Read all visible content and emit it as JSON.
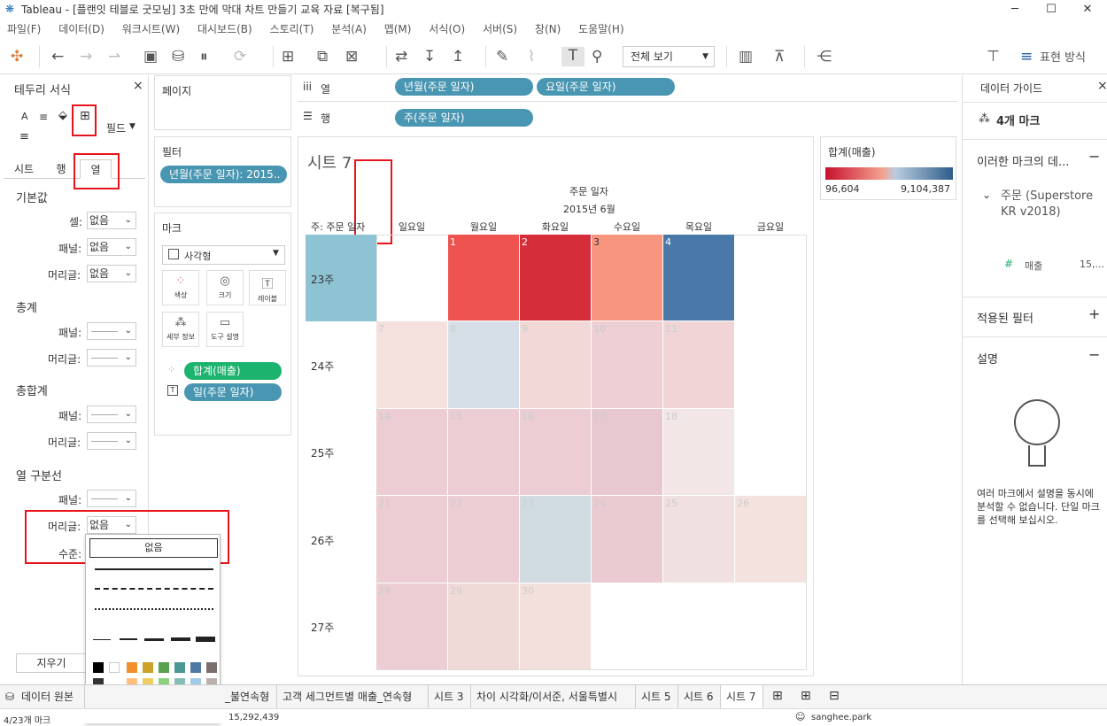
{
  "window": {
    "title": "Tableau - [플랜잇 테블로 굿모닝] 3초 만에 막대 차트 만들기 교육 자료 [복구됨]",
    "minimize": "─",
    "maximize": "☐",
    "close": "✕"
  },
  "menu": [
    "파일(F)",
    "데이터(D)",
    "워크시트(W)",
    "대시보드(B)",
    "스토리(T)",
    "분석(A)",
    "맵(M)",
    "서식(O)",
    "서버(S)",
    "창(N)",
    "도움말(H)"
  ],
  "toolbar": {
    "view_select": "전체 보기",
    "show_me": "표현 방식"
  },
  "format_pane": {
    "title": "테두리 서식",
    "close": "×",
    "fields_label": "필드",
    "tabs": [
      "시트",
      "행",
      "열"
    ],
    "sections": {
      "default": "기본값",
      "totals": "총계",
      "grand_totals": "총합계",
      "col_divider": "열 구분선"
    },
    "labels": {
      "cell": "셀:",
      "pane": "패널:",
      "header": "머리글:",
      "level": "수준:"
    },
    "values": {
      "cell": "없음",
      "pane": "없음",
      "header": "없음",
      "divider_header": "없음"
    },
    "clear_button": "지우기",
    "dropdown_none": "없음"
  },
  "shelves": {
    "pages": "페이지",
    "columns": "열",
    "rows": "행",
    "col_pills": [
      "년월(주문 일자)",
      "요일(주문 일자)"
    ],
    "row_pills": [
      "주(주문 일자)"
    ],
    "filters_title": "필터",
    "filter_pill": "년월(주문 일자): 2015..",
    "marks_title": "마크",
    "mark_type": "사각형",
    "mark_buttons": [
      "색상",
      "크기",
      "레이블",
      "세부 정보",
      "도구 설명"
    ],
    "mark_pills": [
      "합계(매출)",
      "일(주문 일자)"
    ]
  },
  "view": {
    "sheet_title": "시트 7",
    "header_field": "주문 일자",
    "month_label": "2015년 6월",
    "row_field_label": "주: 주문 일자",
    "days": [
      "일요일",
      "월요일",
      "화요일",
      "수요일",
      "목요일",
      "금요일"
    ],
    "weeks": [
      "23주",
      "24주",
      "25주",
      "26주",
      "27주"
    ]
  },
  "chart_data": {
    "type": "heatmap",
    "title": "시트 7",
    "x_field": "요일(주문 일자)",
    "y_field": "주(주문 일자)",
    "color_field": "합계(매출)",
    "color_range": [
      96604,
      9104387
    ],
    "color_range_labels": [
      "96,604",
      "9,104,387"
    ],
    "cells": [
      {
        "week": "23주",
        "day": "월요일",
        "date": "1",
        "color": "#ef5350"
      },
      {
        "week": "23주",
        "day": "화요일",
        "date": "2",
        "color": "#d62d3b"
      },
      {
        "week": "23주",
        "day": "수요일",
        "date": "3",
        "color": "#f7957f"
      },
      {
        "week": "23주",
        "day": "목요일",
        "date": "4",
        "color": "#4a78a8"
      },
      {
        "week": "24주",
        "day": "일요일",
        "date": "7",
        "color": "#f4e1de"
      },
      {
        "week": "24주",
        "day": "월요일",
        "date": "8",
        "color": "#d6dfe8"
      },
      {
        "week": "24주",
        "day": "화요일",
        "date": "9",
        "color": "#f2d8d6"
      },
      {
        "week": "24주",
        "day": "수요일",
        "date": "10",
        "color": "#eecfd3"
      },
      {
        "week": "24주",
        "day": "목요일",
        "date": "11",
        "color": "#f1d5d6"
      },
      {
        "week": "25주",
        "day": "일요일",
        "date": "14",
        "color": "#ebcdd3"
      },
      {
        "week": "25주",
        "day": "월요일",
        "date": "15",
        "color": "#ebcdd3"
      },
      {
        "week": "25주",
        "day": "화요일",
        "date": "16",
        "color": "#ebcdd3"
      },
      {
        "week": "25주",
        "day": "수요일",
        "date": "17",
        "color": "#e8c8d0"
      },
      {
        "week": "25주",
        "day": "목요일",
        "date": "18",
        "color": "#f2e6e6"
      },
      {
        "week": "26주",
        "day": "일요일",
        "date": "21",
        "color": "#ebcdd3"
      },
      {
        "week": "26주",
        "day": "월요일",
        "date": "22",
        "color": "#ebcdd3"
      },
      {
        "week": "26주",
        "day": "화요일",
        "date": "23",
        "color": "#d1dbe2"
      },
      {
        "week": "26주",
        "day": "수요일",
        "date": "24",
        "color": "#e9cbd1"
      },
      {
        "week": "26주",
        "day": "목요일",
        "date": "25",
        "color": "#f1e0e0"
      },
      {
        "week": "26주",
        "day": "금요일",
        "date": "26",
        "color": "#f4e2df"
      },
      {
        "week": "27주",
        "day": "일요일",
        "date": "28",
        "color": "#ebcdd3"
      },
      {
        "week": "27주",
        "day": "월요일",
        "date": "29",
        "color": "#f0dad8"
      },
      {
        "week": "27주",
        "day": "화요일",
        "date": "30",
        "color": "#f3e0dd"
      }
    ]
  },
  "legend": {
    "title": "합계(매출)",
    "min": "96,604",
    "max": "9,104,387"
  },
  "data_guide": {
    "title": "데이터 가이드",
    "close": "×",
    "marks_count": "4개 마크",
    "section_data": "이러한 마크의 데...",
    "source_name": "주문 (Superstore KR v2018)",
    "field": "매출",
    "field_value": "15,...",
    "section_filters": "적용된 필터",
    "section_desc": "설명",
    "desc_text": "여러 마크에서 설명을 동시에 분석할 수 없습니다. 단일 마크를 선택해 보십시오."
  },
  "bottom_tabs": [
    "데이터 원본",
    "_불연속형",
    "고객 세그먼트별 매출_연속형",
    "시트 3",
    "차이 시각화/이서준, 서울특별시",
    "시트 5",
    "시트 6",
    "시트 7"
  ],
  "status": {
    "marks": "4/23개 마크",
    "sum": "15,292,439",
    "user": "sanghee.park"
  }
}
